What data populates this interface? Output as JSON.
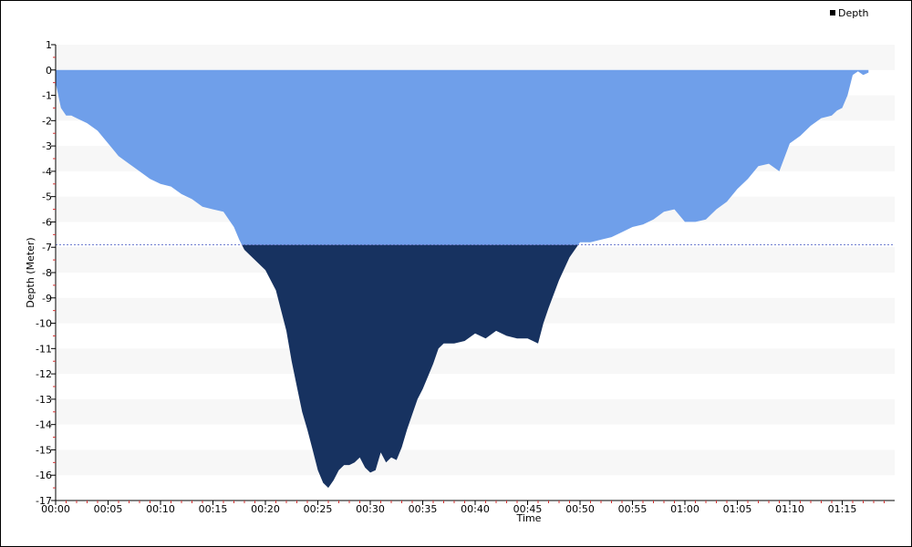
{
  "chart_data": {
    "type": "area",
    "xlabel": "Time",
    "ylabel": "Depth (Meter)",
    "legend": {
      "position": "top-right",
      "entries": [
        "Depth"
      ]
    },
    "ylim": [
      -17,
      1
    ],
    "xlim_minutes": [
      0,
      80
    ],
    "y_ticks": [
      "1",
      "0",
      "-1",
      "-2",
      "-3",
      "-4",
      "-5",
      "-6",
      "-7",
      "-8",
      "-9",
      "-10",
      "-11",
      "-12",
      "-13",
      "-14",
      "-15",
      "-16",
      "-17"
    ],
    "x_ticks": [
      "00:00",
      "00:05",
      "00:10",
      "00:15",
      "00:20",
      "00:25",
      "00:30",
      "00:35",
      "00:40",
      "00:45",
      "00:50",
      "00:55",
      "01:00",
      "01:05",
      "01:10",
      "01:15"
    ],
    "threshold_depth": -6.9,
    "colors": {
      "shallow": "#6f9fea",
      "deep": "#173260",
      "band": "#f7f7f7",
      "threshold": "#6f7fd0"
    },
    "series": [
      {
        "name": "Depth",
        "x_minutes": [
          0,
          0.5,
          1,
          1.5,
          2,
          3,
          4,
          5,
          6,
          7,
          8,
          9,
          10,
          11,
          12,
          13,
          14,
          15,
          16,
          17,
          17.5,
          18,
          18.5,
          19,
          20,
          21,
          21.5,
          22,
          22.5,
          23,
          23.5,
          24,
          24.5,
          25,
          25.5,
          26,
          26.5,
          27,
          27.5,
          28,
          28.5,
          29,
          29.5,
          30,
          30.5,
          31,
          31.5,
          32,
          32.5,
          33,
          33.5,
          34,
          34.5,
          35,
          35.5,
          36,
          36.5,
          37,
          38,
          39,
          40,
          41,
          42,
          43,
          44,
          45,
          45.5,
          46,
          46.5,
          47,
          48,
          49,
          50,
          51,
          52,
          53,
          54,
          55,
          56,
          57,
          58,
          59,
          60,
          61,
          62,
          63,
          64,
          65,
          66,
          67,
          68,
          69,
          70,
          71,
          72,
          73,
          74,
          74.5,
          75,
          75.5,
          76,
          76.5,
          77,
          77.5
        ],
        "depth": [
          -0.5,
          -1.5,
          -1.8,
          -1.8,
          -1.9,
          -2.1,
          -2.4,
          -2.9,
          -3.4,
          -3.7,
          -4.0,
          -4.3,
          -4.5,
          -4.6,
          -4.9,
          -5.1,
          -5.4,
          -5.5,
          -5.6,
          -6.2,
          -6.7,
          -7.1,
          -7.3,
          -7.5,
          -7.9,
          -8.7,
          -9.5,
          -10.3,
          -11.5,
          -12.5,
          -13.5,
          -14.2,
          -15.0,
          -15.8,
          -16.3,
          -16.5,
          -16.2,
          -15.8,
          -15.6,
          -15.6,
          -15.5,
          -15.3,
          -15.7,
          -15.9,
          -15.8,
          -15.1,
          -15.5,
          -15.3,
          -15.4,
          -14.9,
          -14.2,
          -13.6,
          -13.0,
          -12.6,
          -12.1,
          -11.6,
          -11.0,
          -10.8,
          -10.8,
          -10.7,
          -10.4,
          -10.6,
          -10.3,
          -10.5,
          -10.6,
          -10.6,
          -10.7,
          -10.8,
          -10.0,
          -9.4,
          -8.3,
          -7.4,
          -6.8,
          -6.8,
          -6.7,
          -6.6,
          -6.4,
          -6.2,
          -6.1,
          -5.9,
          -5.6,
          -5.5,
          -6.0,
          -6.0,
          -5.9,
          -5.5,
          -5.2,
          -4.7,
          -4.3,
          -3.8,
          -3.7,
          -4.0,
          -2.9,
          -2.6,
          -2.2,
          -1.9,
          -1.8,
          -1.6,
          -1.5,
          -1.0,
          -0.2,
          -0.05,
          -0.2,
          -0.1,
          -0.3,
          -0.1,
          -0.4
        ]
      }
    ]
  }
}
